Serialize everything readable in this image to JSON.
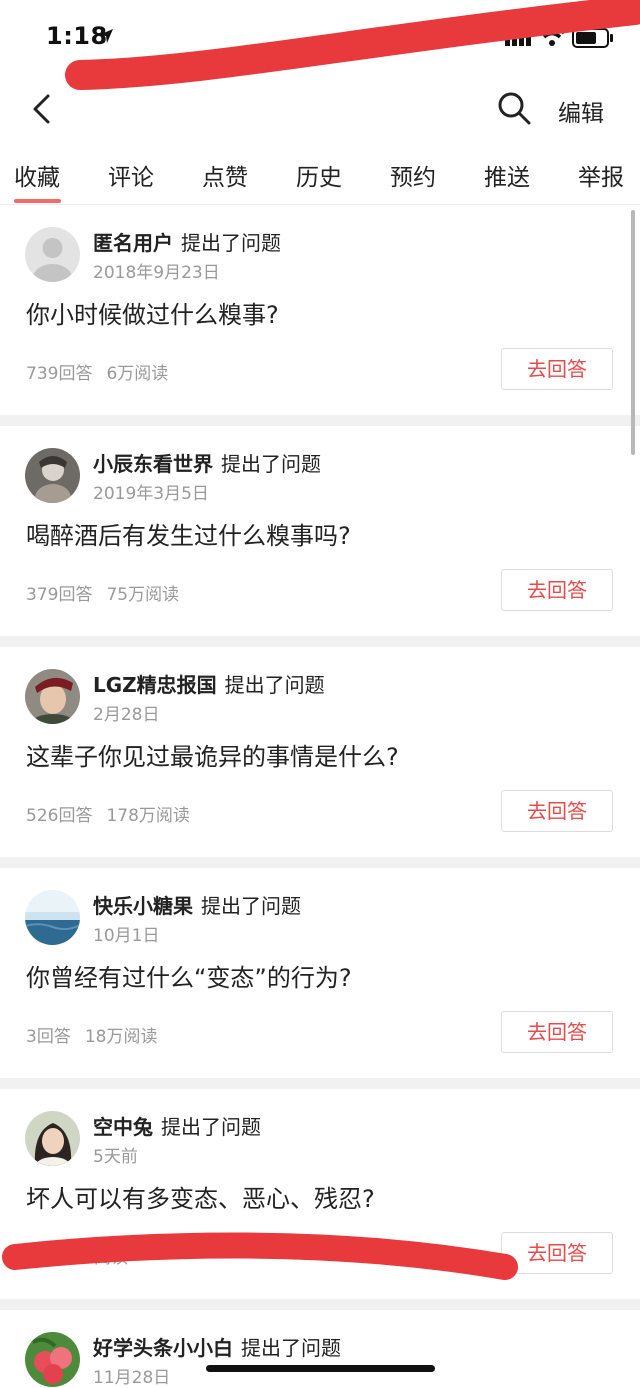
{
  "status_bar": {
    "time": "1:18"
  },
  "header": {
    "edit_label": "编辑"
  },
  "tabs": [
    {
      "label": "收藏",
      "active": true
    },
    {
      "label": "评论"
    },
    {
      "label": "点赞"
    },
    {
      "label": "历史"
    },
    {
      "label": "预约"
    },
    {
      "label": "推送"
    },
    {
      "label": "举报"
    }
  ],
  "questions": [
    {
      "author": "匿名用户",
      "action": "提出了问题",
      "date": "2018年9月23日",
      "title": "你小时候做过什么糗事?",
      "answers": "739回答",
      "reads": "6万阅读",
      "button": "去回答"
    },
    {
      "author": "小辰东看世界",
      "action": "提出了问题",
      "date": "2019年3月5日",
      "title": "喝醉酒后有发生过什么糗事吗?",
      "answers": "379回答",
      "reads": "75万阅读",
      "button": "去回答"
    },
    {
      "author": "LGZ精忠报国",
      "action": "提出了问题",
      "date": "2月28日",
      "title": "这辈子你见过最诡异的事情是什么?",
      "answers": "526回答",
      "reads": "178万阅读",
      "button": "去回答"
    },
    {
      "author": "快乐小糖果",
      "action": "提出了问题",
      "date": "10月1日",
      "title": "你曾经有过什么“变态”的行为?",
      "answers": "3回答",
      "reads": "18万阅读",
      "button": "去回答"
    },
    {
      "author": "空中兔",
      "action": "提出了问题",
      "date": "5天前",
      "title": "坏人可以有多变态、恶心、残忍?",
      "answers": "",
      "reads": "阅读",
      "button": "去回答"
    },
    {
      "author": "好学头条小小白",
      "action": "提出了问题",
      "date": "11月28日"
    }
  ],
  "icons": {
    "back": "chevron-left-icon",
    "search": "search-icon",
    "signal": "signal-icon",
    "wifi": "wifi-icon",
    "battery": "battery-icon",
    "location": "location-arrow-icon"
  },
  "colors": {
    "accent": "#e84a4a",
    "tab_underline": "#f26a6a",
    "redaction": "#e8393d"
  }
}
